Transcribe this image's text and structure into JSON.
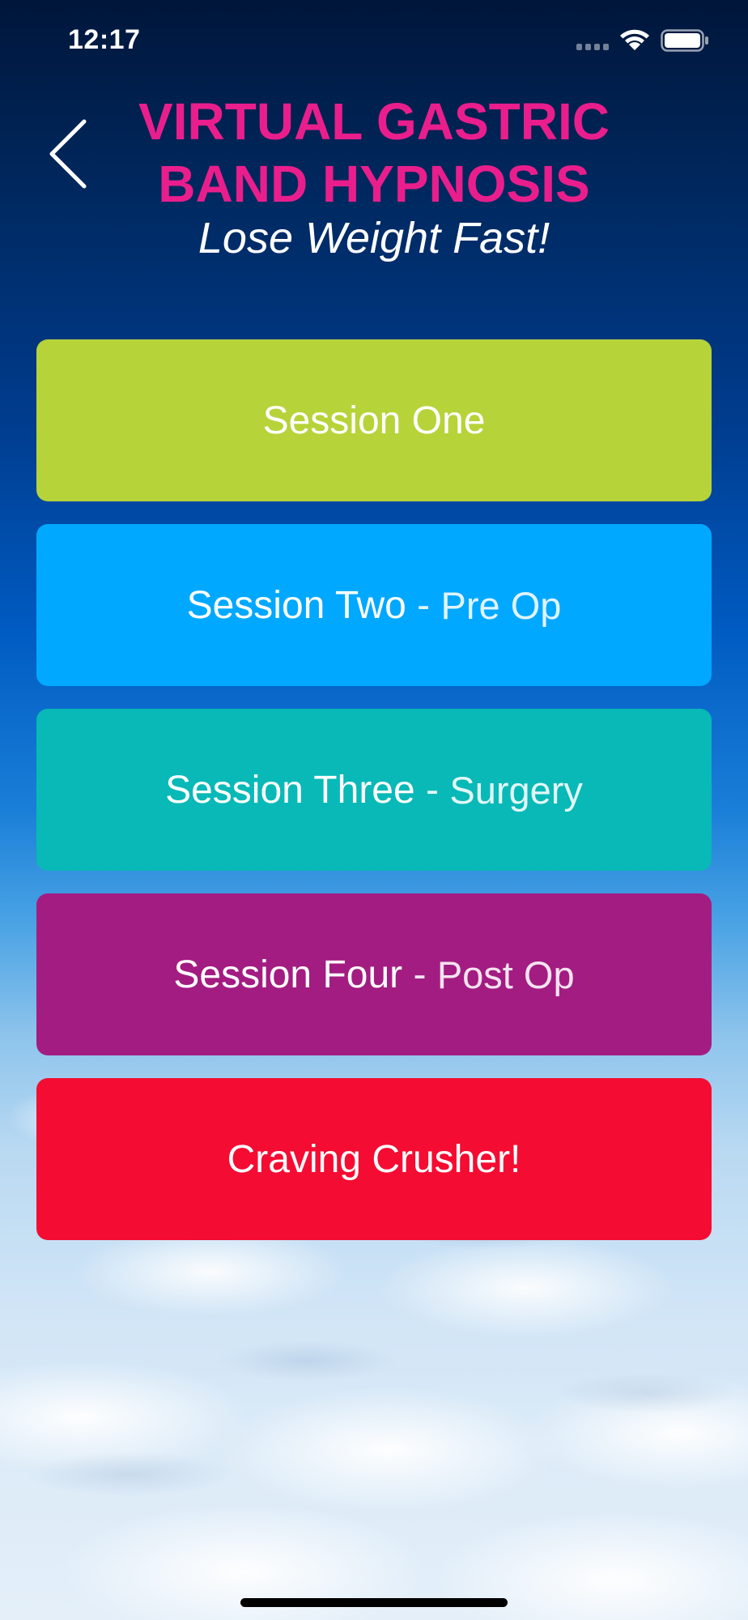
{
  "status_bar": {
    "time": "12:17"
  },
  "header": {
    "back_icon": "chevron-left-icon",
    "title_line_1": "VIRTUAL GASTRIC",
    "title_line_2": "BAND HYPNOSIS",
    "subtitle": "Lose Weight Fast!"
  },
  "sessions": [
    {
      "label": "Session One",
      "separator": "",
      "sublabel": "",
      "color": "#b6d339"
    },
    {
      "label": "Session Two",
      "separator": " - ",
      "sublabel": "Pre Op",
      "color": "#00a8ff"
    },
    {
      "label": "Session Three",
      "separator": " - ",
      "sublabel": "Surgery",
      "color": "#08b9b7"
    },
    {
      "label": "Session Four",
      "separator": " - ",
      "sublabel": "Post Op",
      "color": "#a31c82"
    },
    {
      "label": "Craving Crusher!",
      "separator": "",
      "sublabel": "",
      "color": "#f50c32"
    }
  ],
  "colors": {
    "title": "#e91e8c",
    "text": "#ffffff"
  }
}
